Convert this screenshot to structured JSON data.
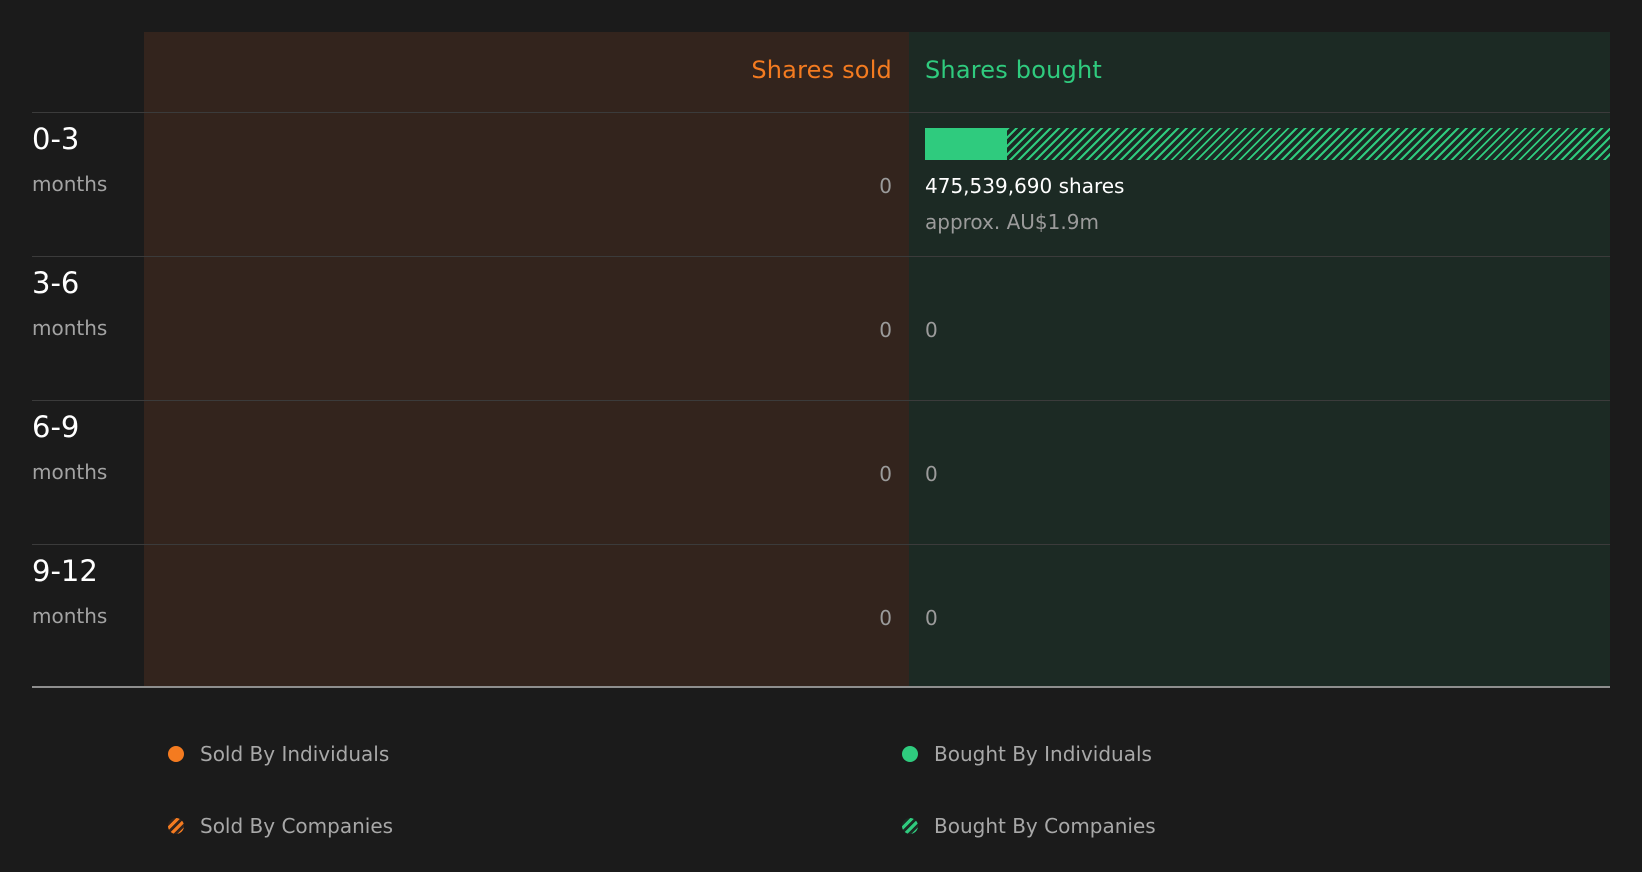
{
  "chart_data": {
    "type": "bar",
    "orientation": "horizontal-diverging",
    "columns": {
      "sold_label": "Shares sold",
      "bought_label": "Shares bought"
    },
    "colors": {
      "sold": "#f47b20",
      "bought": "#2fcb7e"
    },
    "rows": [
      {
        "period": "0-3",
        "unit": "months",
        "sold": 0,
        "sold_label": "0",
        "bought": 475539690,
        "bought_by_individuals_fraction": 0.12,
        "bought_label": "475,539,690 shares",
        "bought_value_label": "approx. AU$1.9m"
      },
      {
        "period": "3-6",
        "unit": "months",
        "sold": 0,
        "sold_label": "0",
        "bought": 0,
        "bought_label": "0"
      },
      {
        "period": "6-9",
        "unit": "months",
        "sold": 0,
        "sold_label": "0",
        "bought": 0,
        "bought_label": "0"
      },
      {
        "period": "9-12",
        "unit": "months",
        "sold": 0,
        "sold_label": "0",
        "bought": 0,
        "bought_label": "0"
      }
    ],
    "legend": [
      {
        "label": "Sold By Individuals",
        "color": "#f47b20",
        "pattern": "solid"
      },
      {
        "label": "Bought By Individuals",
        "color": "#2fcb7e",
        "pattern": "solid"
      },
      {
        "label": "Sold By Companies",
        "color": "#f47b20",
        "pattern": "hatched"
      },
      {
        "label": "Bought By Companies",
        "color": "#2fcb7e",
        "pattern": "hatched"
      }
    ]
  }
}
